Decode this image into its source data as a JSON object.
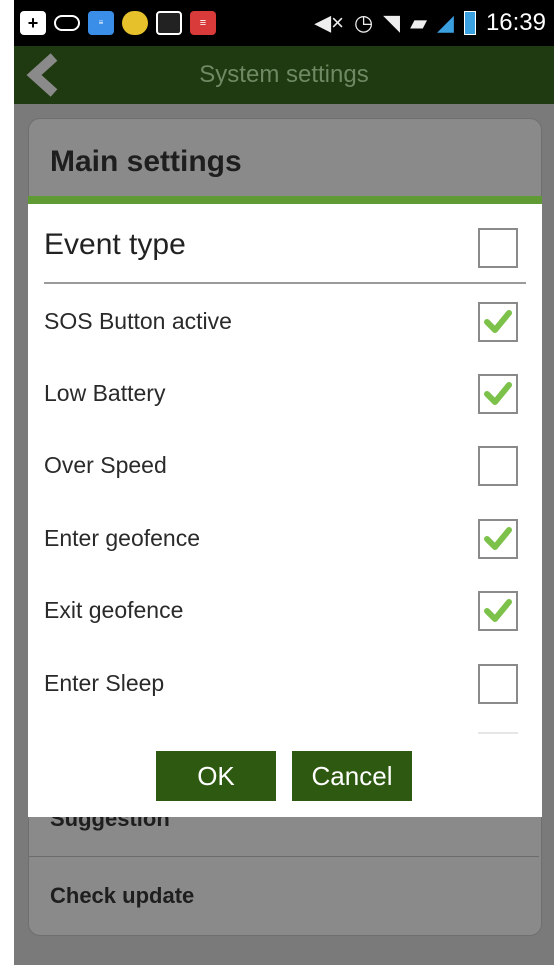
{
  "status_bar": {
    "time": "16:39",
    "left_icons": [
      "add-icon",
      "cloud-icon",
      "news-icon",
      "flower-app-icon",
      "image-icon",
      "news-app-icon"
    ],
    "right_icons": [
      "mute-icon",
      "alarm-icon",
      "wifi-icon",
      "sim-icon",
      "signal-icon",
      "battery-icon"
    ]
  },
  "title_bar": {
    "title": "System settings",
    "back_icon": "back-arrow-icon"
  },
  "background": {
    "heading": "Main settings",
    "items": [
      "Suggestion",
      "Check update"
    ]
  },
  "dialog": {
    "title": "Event type",
    "select_all_checked": false,
    "options": [
      {
        "label": "SOS Button active",
        "checked": true
      },
      {
        "label": "Low Battery",
        "checked": true
      },
      {
        "label": "Over Speed",
        "checked": false
      },
      {
        "label": "Enter geofence",
        "checked": true
      },
      {
        "label": "Exit geofence",
        "checked": true
      },
      {
        "label": "Enter Sleep",
        "checked": false
      }
    ],
    "ok_label": "OK",
    "cancel_label": "Cancel"
  },
  "colors": {
    "accent": "#5f9a35",
    "button": "#2d5a10",
    "title_bar": "#1f3a10",
    "check": "#7cc24a"
  }
}
